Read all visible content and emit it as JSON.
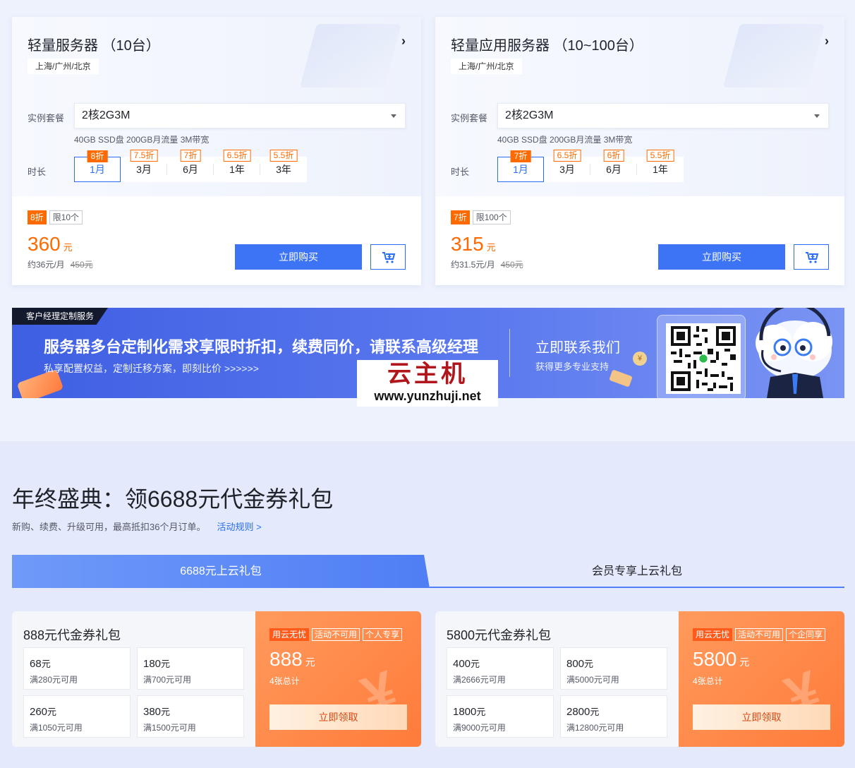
{
  "cards": [
    {
      "title": "轻量服务器 （10台）",
      "region": "上海/广州/北京",
      "package_label": "实例套餐",
      "package_value": "2核2G3M",
      "spec": "40GB SSD盘 200GB月流量 3M带宽",
      "duration_label": "时长",
      "durations": [
        {
          "label": "1月",
          "discount": "8折",
          "active": true
        },
        {
          "label": "3月",
          "discount": "7.5折"
        },
        {
          "label": "6月",
          "discount": "7折"
        },
        {
          "label": "1年",
          "discount": "6.5折"
        },
        {
          "label": "3年",
          "discount": "5.5折"
        }
      ],
      "badge_discount": "8折",
      "badge_limit": "限10个",
      "price": "360",
      "price_unit": "元",
      "monthly": "约36元/月",
      "original": "450元",
      "buy_label": "立即购买"
    },
    {
      "title": "轻量应用服务器 （10~100台）",
      "region": "上海/广州/北京",
      "package_label": "实例套餐",
      "package_value": "2核2G3M",
      "spec": "40GB SSD盘 200GB月流量 3M带宽",
      "duration_label": "时长",
      "durations": [
        {
          "label": "1月",
          "discount": "7折",
          "active": true
        },
        {
          "label": "3月",
          "discount": "6.5折"
        },
        {
          "label": "6月",
          "discount": "6折"
        },
        {
          "label": "1年",
          "discount": "5.5折"
        }
      ],
      "badge_discount": "7折",
      "badge_limit": "限100个",
      "price": "315",
      "price_unit": "元",
      "monthly": "约31.5元/月",
      "original": "450元",
      "buy_label": "立即购买"
    }
  ],
  "banner": {
    "tag": "客户经理定制服务",
    "headline": "服务器多台定制化需求享限时折扣，续费同价，请联系高级经理",
    "subline": "私享配置权益，定制迁移方案，即刻比价 >>>>>>",
    "contact": "立即联系我们",
    "contact_sub": "获得更多专业支持",
    "coin": "¥"
  },
  "watermark": {
    "title": "云主机",
    "url": "www.yunzhuji.net"
  },
  "section": {
    "title": "年终盛典：领6688元代金券礼包",
    "subtitle": "新购、续费、升级可用，最高抵扣36个月订单。",
    "rules_link": "活动规则 >"
  },
  "tabs": [
    {
      "label": "6688元上云礼包",
      "active": true
    },
    {
      "label": "会员专享上云礼包",
      "active": false
    }
  ],
  "packs": [
    {
      "title": "888元代金券礼包",
      "coupons": [
        {
          "amount": "68",
          "unit": "元",
          "condition": "满280元可用"
        },
        {
          "amount": "180",
          "unit": "元",
          "condition": "满700元可用"
        },
        {
          "amount": "260",
          "unit": "元",
          "condition": "满1050元可用"
        },
        {
          "amount": "380",
          "unit": "元",
          "condition": "满1500元可用"
        }
      ],
      "tags": [
        "用云无忧",
        "活动不可用",
        "个人专享"
      ],
      "total": "888",
      "total_unit": "元",
      "count": "4张总计",
      "claim_label": "立即领取"
    },
    {
      "title": "5800元代金券礼包",
      "coupons": [
        {
          "amount": "400",
          "unit": "元",
          "condition": "满2666元可用"
        },
        {
          "amount": "800",
          "unit": "元",
          "condition": "满5000元可用"
        },
        {
          "amount": "1800",
          "unit": "元",
          "condition": "满9000元可用"
        },
        {
          "amount": "2800",
          "unit": "元",
          "condition": "满12800元可用"
        }
      ],
      "tags": [
        "用云无忧",
        "活动不可用",
        "个企同享"
      ],
      "total": "5800",
      "total_unit": "元",
      "count": "4张总计",
      "claim_label": "立即领取"
    }
  ],
  "colors": {
    "accent": "#2a6df4",
    "discount": "#ff6a00",
    "buy_button": "#3d74f6",
    "pack_orange": "#ff7b3a"
  },
  "icons": {
    "card_arrow": "chevron-right-icon",
    "cart": "add-cart-icon",
    "select_caret": "caret-down-icon",
    "yen": "yen-icon"
  }
}
